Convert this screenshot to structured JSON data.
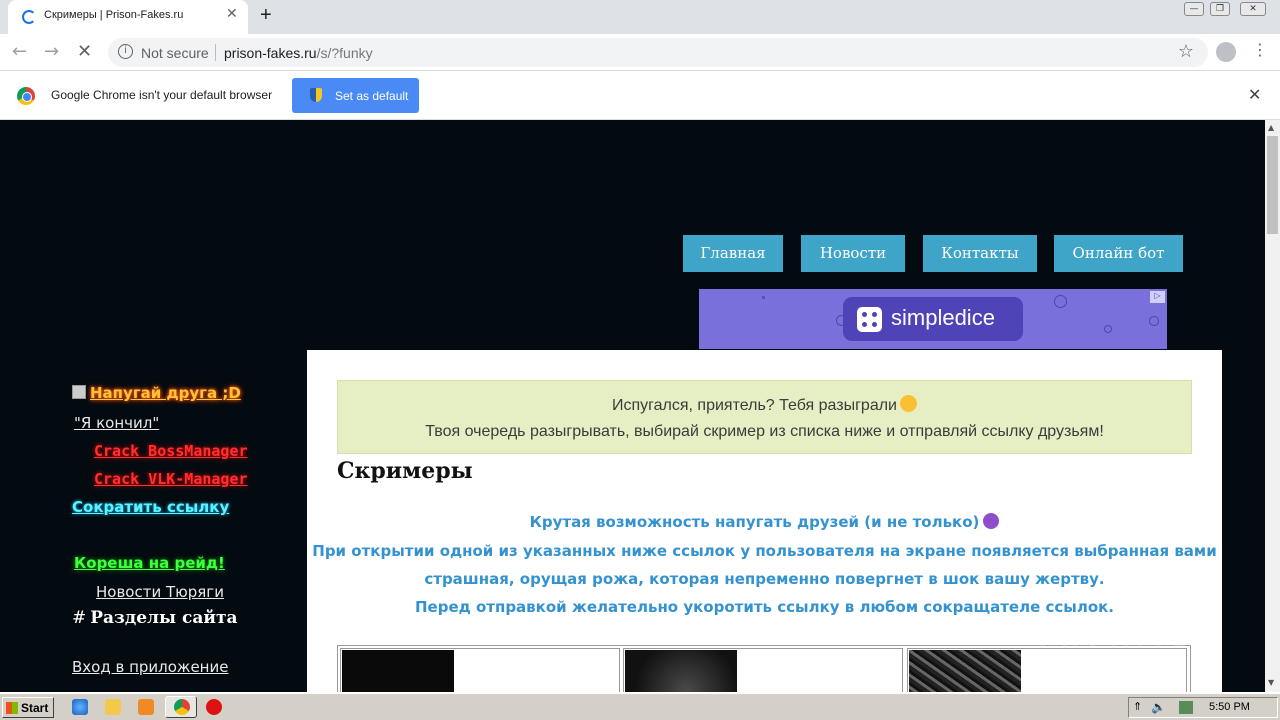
{
  "browser": {
    "tab_title": "Скримеры | Prison-Fakes.ru",
    "security_label": "Not secure",
    "url_host": "prison-fakes.ru",
    "url_path": "/s/?funky",
    "infobar_message": "Google Chrome isn't your default browser",
    "set_default_label": "Set as default"
  },
  "nav": {
    "items": [
      "Главная",
      "Новости",
      "Контакты",
      "Онлайн бот"
    ]
  },
  "ad": {
    "brand": "simpledice",
    "colors": {
      "background": "#7a70dc",
      "brand_box": "#4f43b8"
    }
  },
  "sidebar": {
    "scare_link": "Напугай друга ;D",
    "quote_link": "\"Я кончил\"",
    "crack_boss": "Crack BossManager",
    "crack_vlk": "Crack VLK-Manager",
    "shorten_link": "Сократить ссылку",
    "raid_link": "Кореша на рейд!",
    "news_link": "Новости Тюряги",
    "sections_heading": "Разделы сайта",
    "sections_icon": "#",
    "app_login": "Вход в приложение"
  },
  "content": {
    "notice_line1": "Испугался, приятель? Тебя разыграли",
    "notice_line2": "Твоя очередь разыгрывать, выбирай скример из списка ниже и отправляй ссылку друзьям!",
    "title": "Скримеры",
    "desc_line1": "Крутая возможность напугать друзей (и не только)",
    "desc_line2": "При открытии одной из указанных ниже ссылок у пользователя на экране появляется выбранная вами",
    "desc_line3": "страшная, орущая рожа, которая непременно повергнет в шок вашу жертву.",
    "desc_line4": "Перед отправкой желательно укоротить ссылку в любом сокращателе ссылок."
  },
  "watermark": "ANY.RUN",
  "taskbar": {
    "start_label": "Start",
    "clock": "5:50 PM"
  },
  "colors": {
    "nav_button": "#3ea4c8",
    "page_background": "#040b10",
    "notice_background": "#e6efc4",
    "desc_text": "#3592d0",
    "chrome_accent": "#4a8af4"
  }
}
